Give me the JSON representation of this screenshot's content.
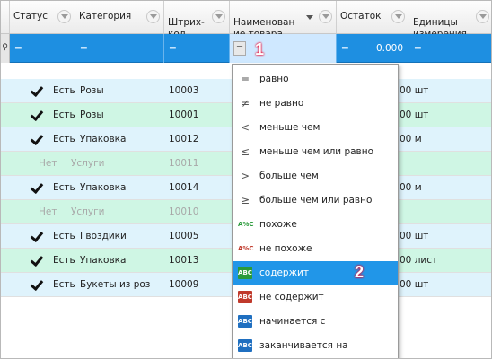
{
  "columns": [
    {
      "label": "Статус"
    },
    {
      "label": "Категория"
    },
    {
      "label": "Штрих-\nкод"
    },
    {
      "label": "Наименован\nие товара"
    },
    {
      "label": "Остаток"
    },
    {
      "label": "Единицы\nизмерения"
    }
  ],
  "filter_row": {
    "eq_symbol": "═",
    "remaining_value": "0.000"
  },
  "badges": {
    "first": "1",
    "second": "2"
  },
  "rows": [
    {
      "status": "Есть",
      "category": "Розы",
      "barcode": "10003",
      "unit": "00 шт",
      "active": true
    },
    {
      "status": "Есть",
      "category": "Розы",
      "barcode": "10001",
      "unit": "00 шт",
      "active": true
    },
    {
      "status": "Есть",
      "category": "Упаковка",
      "barcode": "10012",
      "unit": "00 м",
      "active": true
    },
    {
      "status": "Нет",
      "category": "Услуги",
      "barcode": "10011",
      "unit": "",
      "active": false
    },
    {
      "status": "Есть",
      "category": "Упаковка",
      "barcode": "10014",
      "unit": "00 м",
      "active": true
    },
    {
      "status": "Нет",
      "category": "Услуги",
      "barcode": "10010",
      "unit": "",
      "active": false
    },
    {
      "status": "Есть",
      "category": "Гвоздики",
      "barcode": "10005",
      "unit": "00 шт",
      "active": true
    },
    {
      "status": "Есть",
      "category": "Упаковка",
      "barcode": "10013",
      "unit": "00 лист",
      "active": true
    },
    {
      "status": "Есть",
      "category": "Букеты из роз",
      "barcode": "10009",
      "unit": "00 шт",
      "active": true
    }
  ],
  "dropdown_items": [
    {
      "icon": "═",
      "label": "равно"
    },
    {
      "icon": "≠",
      "label": "не равно"
    },
    {
      "icon": "<",
      "label": "меньше чем"
    },
    {
      "icon": "≤",
      "label": "меньше чем или равно"
    },
    {
      "icon": ">",
      "label": "больше чем"
    },
    {
      "icon": "≥",
      "label": "больше чем или равно"
    },
    {
      "icon": "A%C",
      "label": "похоже"
    },
    {
      "icon": "A%C",
      "label": "не похоже"
    },
    {
      "icon": "ABC",
      "label": "содержит",
      "selected": true
    },
    {
      "icon": "ABC",
      "label": "не содержит"
    },
    {
      "icon": "ABC",
      "label": "начинается с"
    },
    {
      "icon": "ABC",
      "label": "заканчивается на"
    }
  ],
  "colors": {
    "filter_row": "#1e8fe1",
    "selected_item": "#2196e8",
    "row_green": "#cff6e4",
    "row_blue": "#dff3fc",
    "badge": "#f0002a"
  },
  "icon_names": [
    "equals-icon",
    "not-equals-icon",
    "less-than-icon",
    "less-or-equal-icon",
    "greater-than-icon",
    "greater-or-equal-icon",
    "like-icon",
    "not-like-icon",
    "contains-icon",
    "not-contains-icon",
    "starts-with-icon",
    "ends-with-icon"
  ]
}
